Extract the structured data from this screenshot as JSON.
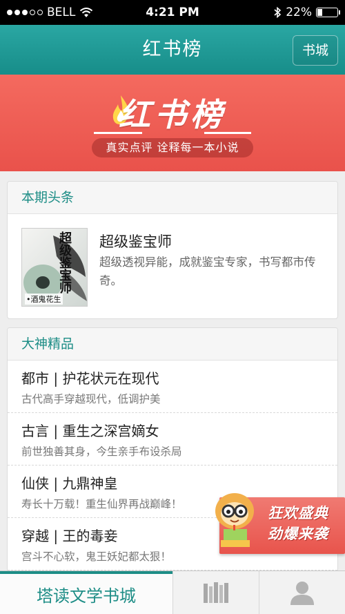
{
  "status_bar": {
    "carrier": "BELL",
    "time": "4:21 PM",
    "battery": "22%",
    "battery_level": 0.22
  },
  "nav": {
    "title": "红书榜",
    "shop_button": "书城"
  },
  "banner": {
    "logo_text": "红书榜",
    "slogan": "真实点评 诠释每一本小说"
  },
  "headline": {
    "header": "本期头条",
    "book": {
      "title": "超级鉴宝师",
      "description": "超级透视异能，成就鉴宝专家，书写都市传奇。",
      "cover_title": "超级鉴宝师",
      "cover_author": "•酒鬼花生"
    }
  },
  "masters": {
    "header": "大神精品",
    "items": [
      {
        "title": "都市 | 护花状元在现代",
        "subtitle": "古代高手穿越现代，低调护美"
      },
      {
        "title": "古言 | 重生之深宫嫡女",
        "subtitle": "前世独善其身，今生亲手布设杀局"
      },
      {
        "title": "仙侠 | 九鼎神皇",
        "subtitle": "寿长十万载！重生仙界再战巅峰！"
      },
      {
        "title": "穿越 | 王的毒妾",
        "subtitle": "宫斗不心软，鬼王妖妃都太狠！"
      }
    ]
  },
  "promo": {
    "line1": "狂欢盛典",
    "line2": "劲爆来袭"
  },
  "tabs": {
    "shop": "塔读文学书城",
    "shelf_icon": "bookshelf-icon",
    "user_icon": "user-icon"
  },
  "colors": {
    "accent": "#1d8d86",
    "banner": "#e9524b",
    "nav": "#2aa7a3"
  }
}
